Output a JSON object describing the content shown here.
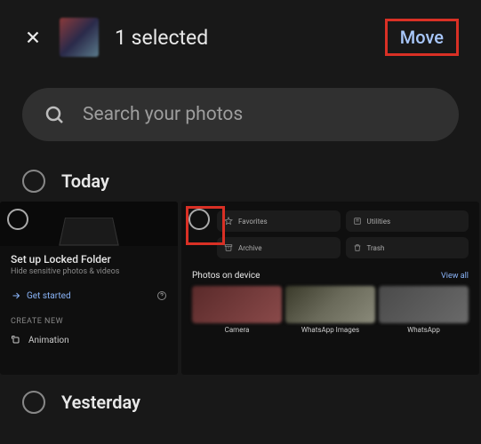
{
  "topbar": {
    "selected_count_text": "1 selected",
    "move_label": "Move"
  },
  "search": {
    "placeholder": "Search your photos"
  },
  "sections": {
    "today_label": "Today",
    "yesterday_label": "Yesterday"
  },
  "thumb1": {
    "title": "Set up Locked Folder",
    "subtitle": "Hide sensitive photos & videos",
    "link": "Get started",
    "create_header": "CREATE NEW",
    "menu_item1": "Animation"
  },
  "thumb2": {
    "chips": {
      "favorites": "Favorites",
      "utilities": "Utilities",
      "archive": "Archive",
      "trash": "Trash"
    },
    "photos_header": "Photos on device",
    "view_all": "View all",
    "devices": {
      "camera": "Camera",
      "whatsapp_images": "WhatsApp Images",
      "whatsapp": "WhatsApp"
    }
  }
}
